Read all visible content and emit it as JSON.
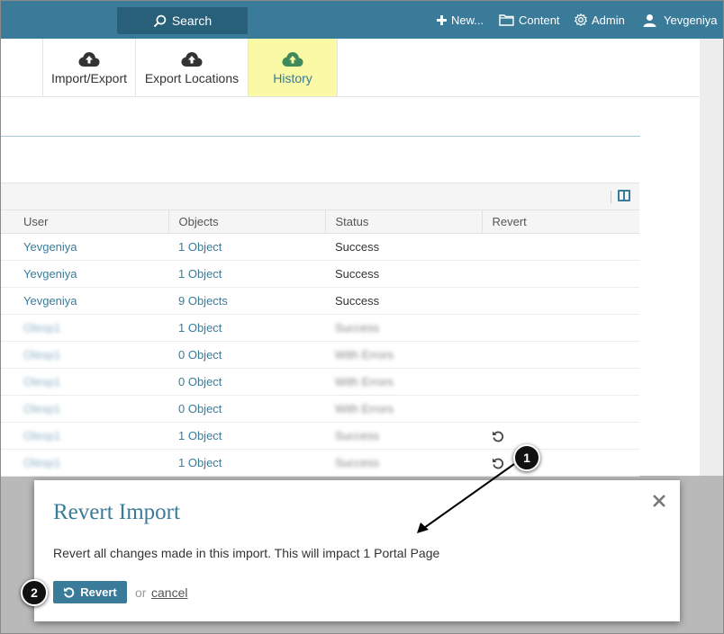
{
  "nav": {
    "search_label": "Search",
    "new_label": "New...",
    "content_label": "Content",
    "admin_label": "Admin",
    "user_label": "Yevgeniya"
  },
  "tabs": [
    {
      "label": "Import/Export",
      "icon": "cloud-upload-icon",
      "active": false
    },
    {
      "label": "Export Locations",
      "icon": "cloud-upload-icon",
      "active": false
    },
    {
      "label": "History",
      "icon": "cloud-upload-icon",
      "active": true
    }
  ],
  "table": {
    "columns": [
      "User",
      "Objects",
      "Status",
      "Revert"
    ],
    "rows": [
      {
        "user": "Yevgeniya",
        "objects": "1 Object",
        "status": "Success",
        "revert": false
      },
      {
        "user": "Yevgeniya",
        "objects": "1 Object",
        "status": "Success",
        "revert": false
      },
      {
        "user": "Yevgeniya",
        "objects": "9 Objects",
        "status": "Success",
        "revert": false
      },
      {
        "user": "Olesp1",
        "objects": "1 Object",
        "status": "Success",
        "revert": false
      },
      {
        "user": "Olesp1",
        "objects": "0 Object",
        "status": "With Errors",
        "revert": false
      },
      {
        "user": "Olesp1",
        "objects": "0 Object",
        "status": "With Errors",
        "revert": false
      },
      {
        "user": "Olesp1",
        "objects": "0 Object",
        "status": "With Errors",
        "revert": false
      },
      {
        "user": "Olesp1",
        "objects": "1 Object",
        "status": "Success",
        "revert": true
      },
      {
        "user": "Olesp1",
        "objects": "1 Object",
        "status": "Success",
        "revert": true
      }
    ]
  },
  "modal": {
    "title": "Revert Import",
    "message": "Revert all changes made in this import. This will impact 1 Portal Page",
    "revert_label": "Revert",
    "or_text": "or",
    "cancel_label": "cancel"
  },
  "callouts": [
    "1",
    "2"
  ],
  "colors": {
    "brand": "#3a7b99",
    "active_tab": "#f9f9a6"
  }
}
